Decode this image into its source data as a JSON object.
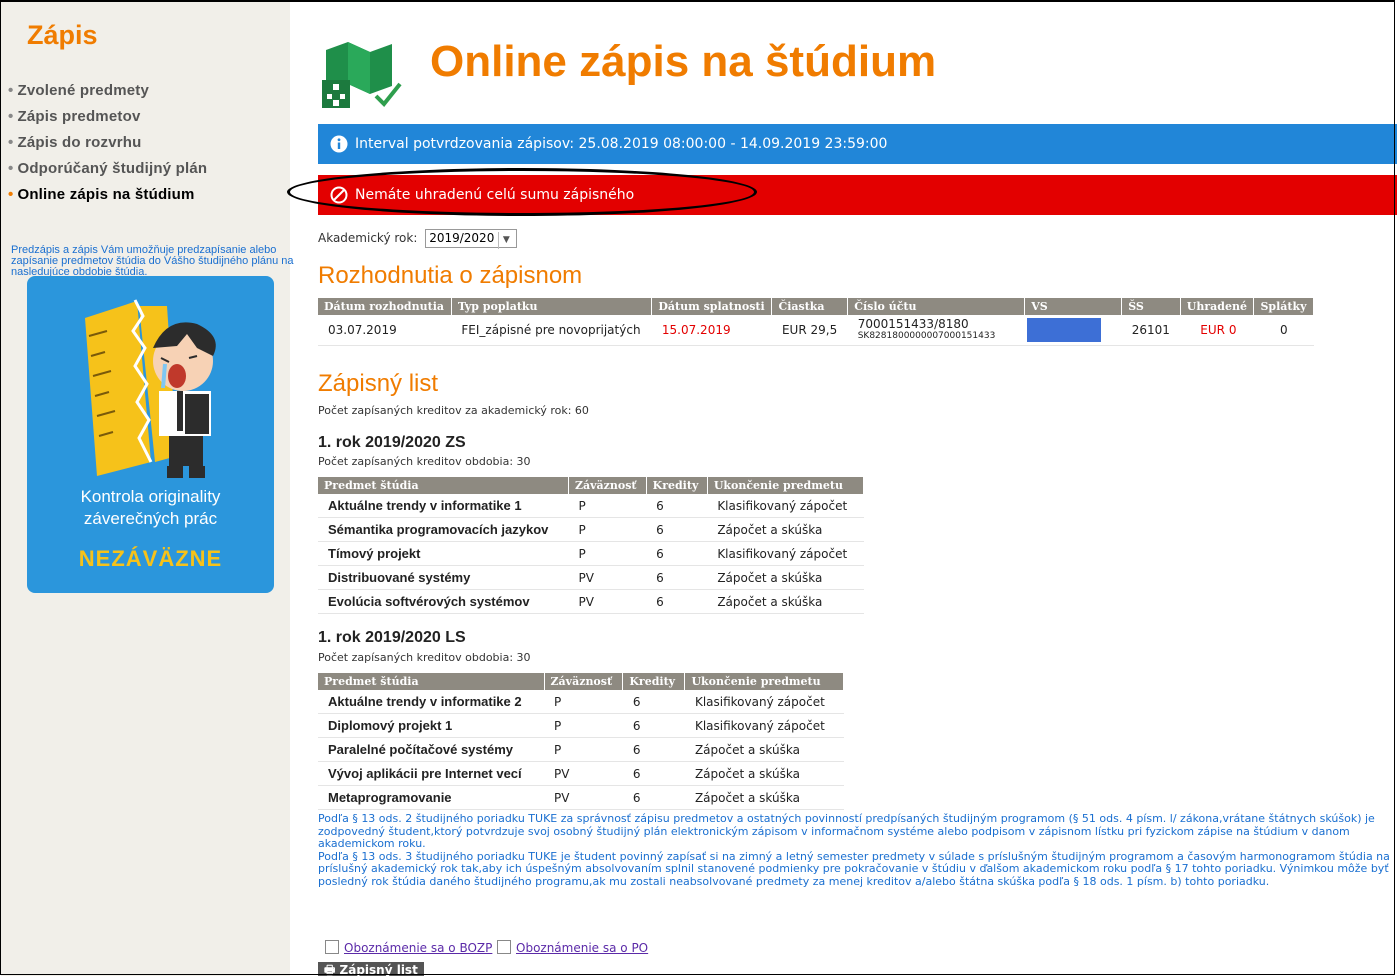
{
  "sidebar": {
    "title": "Zápis",
    "items": [
      {
        "label": "Zvolené predmety"
      },
      {
        "label": "Zápis predmetov"
      },
      {
        "label": "Zápis do rozvrhu"
      },
      {
        "label": "Odporúčaný študijný plán"
      },
      {
        "label": "Online zápis na štúdium"
      }
    ],
    "description": "Predzápis a zápis Vám umožňuje predzapísanie alebo zapísanie predmetov štúdia do Vášho študijného plánu na nasledujúce obdobie štúdia.",
    "ad": {
      "text_line1": "Kontrola originality",
      "text_line2": "záverečných prác",
      "cta": "NEZÁVÄZNE"
    }
  },
  "header": {
    "title": "Online zápis na štúdium"
  },
  "alerts": {
    "info": "Interval potvrdzovania zápisov: 25.08.2019 08:00:00 - 14.09.2019 23:59:00",
    "error": "Nemáte uhradenú celú sumu zápisného"
  },
  "academic_year": {
    "label": "Akademický rok:",
    "value": "2019/2020"
  },
  "decisions": {
    "title": "Rozhodnutia o zápisnom",
    "columns": [
      "Dátum rozhodnutia",
      "Typ poplatku",
      "Dátum splatnosti",
      "Čiastka",
      "Číslo účtu",
      "VS",
      "ŠS",
      "Uhradené",
      "Splátky"
    ],
    "row": {
      "date": "03.07.2019",
      "type": "FEI_zápisné pre novoprijatých",
      "due": "15.07.2019",
      "amount": "EUR 29,5",
      "account": "7000151433/8180",
      "iban": "SK8281800000007000151433",
      "ss": "26101",
      "paid": "EUR 0",
      "installments": "0"
    }
  },
  "zapisny_list": {
    "title": "Zápisný list",
    "total_credits": "Počet zapísaných kreditov za akademický rok: 60",
    "columns": [
      "Predmet štúdia",
      "Záväznosť",
      "Kredity",
      "Ukončenie predmetu"
    ],
    "zs": {
      "title": "1. rok 2019/2020 ZS",
      "credits": "Počet zapísaných kreditov obdobia: 30",
      "rows": [
        [
          "Aktuálne trendy v informatike 1",
          "P",
          "6",
          "Klasifikovaný zápočet"
        ],
        [
          "Sémantika programovacích jazykov",
          "P",
          "6",
          "Zápočet a skúška"
        ],
        [
          "Tímový projekt",
          "P",
          "6",
          "Klasifikovaný zápočet"
        ],
        [
          "Distribuované systémy",
          "PV",
          "6",
          "Zápočet a skúška"
        ],
        [
          "Evolúcia softvérových systémov",
          "PV",
          "6",
          "Zápočet a skúška"
        ]
      ]
    },
    "ls": {
      "title": "1. rok 2019/2020 LS",
      "credits": "Počet zapísaných kreditov obdobia: 30",
      "rows": [
        [
          "Aktuálne trendy v informatike 2",
          "P",
          "6",
          "Klasifikovaný zápočet"
        ],
        [
          "Diplomový projekt 1",
          "P",
          "6",
          "Klasifikovaný zápočet"
        ],
        [
          "Paralelné počítačové systémy",
          "P",
          "6",
          "Zápočet a skúška"
        ],
        [
          "Vývoj aplikácii pre Internet vecí",
          "PV",
          "6",
          "Zápočet a skúška"
        ],
        [
          "Metaprogramovanie",
          "PV",
          "6",
          "Zápočet a skúška"
        ]
      ]
    }
  },
  "notes": {
    "p1": "Podľa § 13 ods. 2 študijného poriadku TUKE za správnosť zápisu predmetov a ostatných povinností predpísaných študijným programom (§ 51 ods. 4 písm. l/ zákona,vrátane štátnych skúšok) je zodpovedný študent,ktorý potvrdzuje svoj osobný študijný plán elektronickým zápisom v informačnom systéme alebo podpisom v zápisnom lístku pri fyzickom zápise na štúdium v danom akademickom roku.",
    "p2": "Podľa § 13 ods. 3 študijného poriadku TUKE je študent povinný zapísať si na zimný a letný semester predmety v súlade s príslušným študijným programom a časovým harmonogramom štúdia na príslušný akademický rok tak,aby ich úspešným absolvovaním splnil stanovené podmienky pre pokračovanie v štúdiu v ďalšom akademickom roku podľa § 17 tohto poriadku. Výnimkou môže byť posledný rok štúdia daného študijného programu,ak mu zostali neabsolvované predmety za menej kreditov a/alebo štátna skúška podľa § 18 ods. 1 písm. b) tohto poriadku."
  },
  "checkboxes": {
    "bozp": "Oboznámenie sa o BOZP",
    "po": "Oboznámenie sa o PO"
  },
  "print_button": "Zápisný list"
}
